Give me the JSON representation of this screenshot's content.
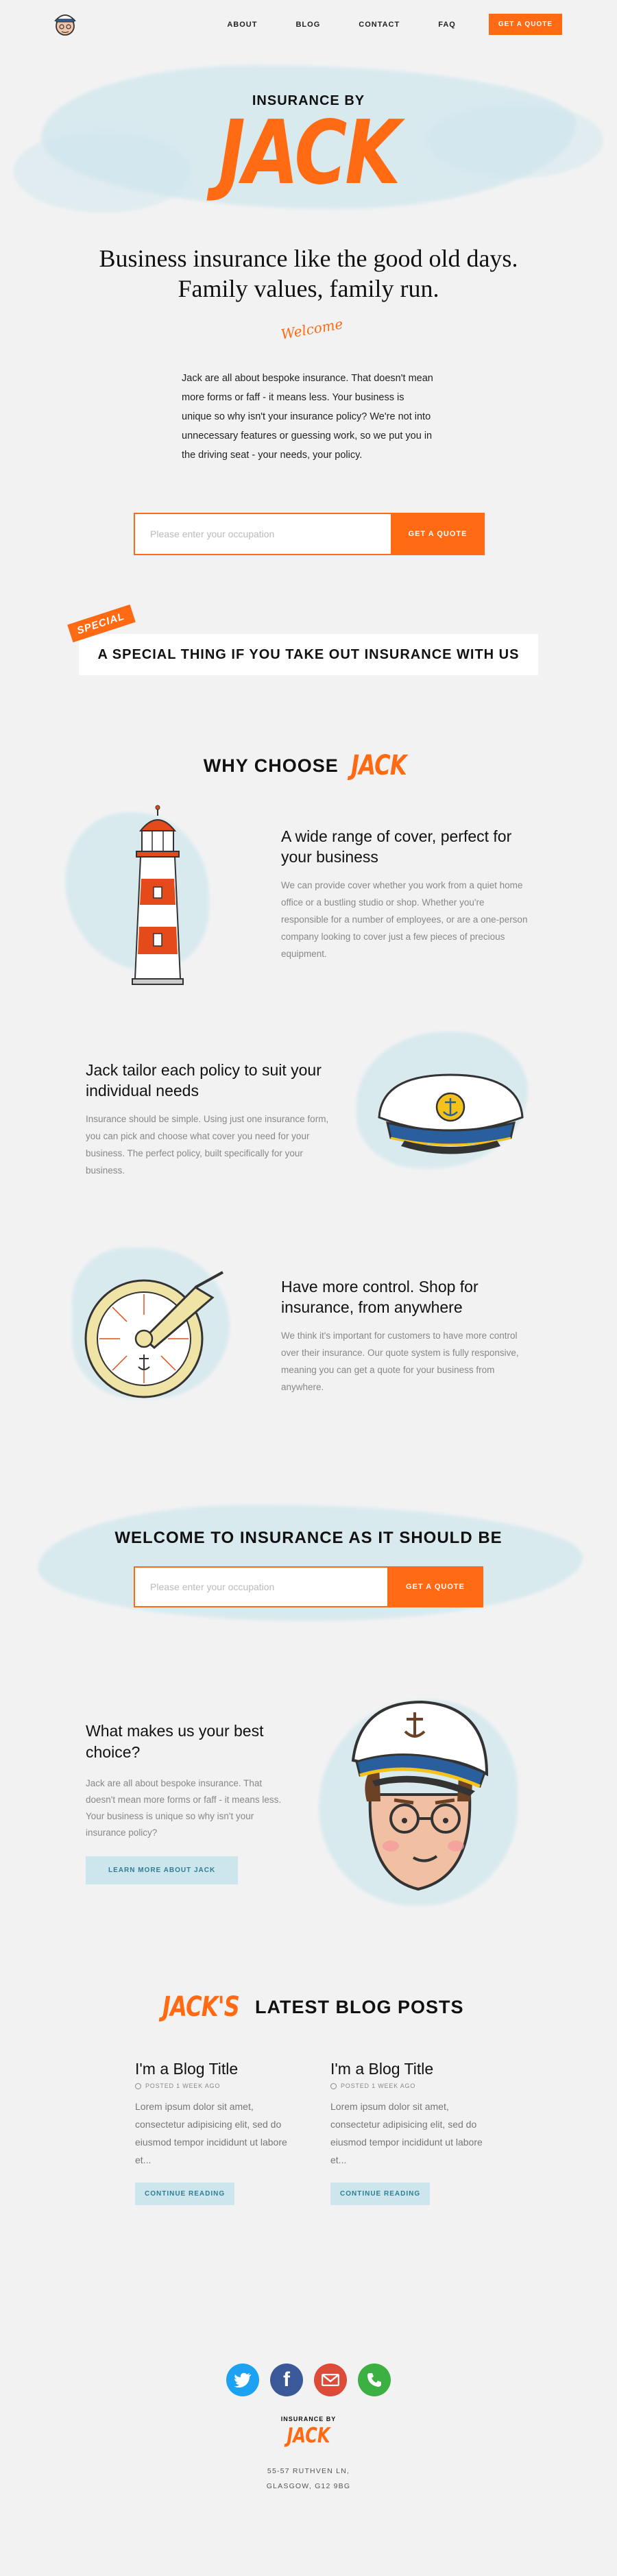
{
  "header": {
    "nav": [
      "ABOUT",
      "BLOG",
      "CONTACT",
      "FAQ"
    ],
    "quote_button": "GET A QUOTE"
  },
  "hero": {
    "small_title": "INSURANCE BY",
    "big_title": "JACK",
    "tagline_line1": "Business insurance like the good old days.",
    "tagline_line2": "Family values, family run.",
    "welcome": "Welcome",
    "intro": "Jack are all about bespoke insurance. That doesn't mean more forms or faff - it means less. Your business is unique so why isn't your insurance policy? We're not into unnecessary features or guessing work, so we put you in the driving seat - your needs, your policy.",
    "input_placeholder": "Please enter your occupation",
    "button": "GET A QUOTE"
  },
  "special": {
    "tag": "SPECIAL",
    "text": "A SPECIAL THING IF YOU TAKE OUT INSURANCE WITH US"
  },
  "why": {
    "title": "WHY CHOOSE",
    "accent": "JACK",
    "features": [
      {
        "title": "A wide range of cover, perfect for your business",
        "body": "We can provide cover whether you work from a quiet home office or a bustling studio or shop. Whether you're responsible for a number of employees, or are a one-person company looking to cover just a few pieces of precious equipment."
      },
      {
        "title": "Jack tailor each policy to suit your individual needs",
        "body": "Insurance should be simple. Using just one insurance form, you can pick and choose what cover you need for your business. The perfect policy, built specifically for your business."
      },
      {
        "title": "Have more control. Shop for insurance, from anywhere",
        "body": "We think it's important for customers to have more control over their insurance. Our quote system is fully responsive, meaning you can get a quote for your business from anywhere."
      }
    ]
  },
  "welcome_section": {
    "title": "WELCOME TO INSURANCE AS IT SHOULD BE",
    "input_placeholder": "Please enter your occupation",
    "button": "GET A QUOTE"
  },
  "best_choice": {
    "title": "What makes us your best choice?",
    "body": "Jack are all about bespoke insurance. That doesn't mean more forms or faff - it means less. Your business is unique so why isn't your insurance policy?",
    "button": "LEARN MORE ABOUT JACK"
  },
  "blog": {
    "accent": "JACK'S",
    "title": "LATEST BLOG POSTS",
    "posts": [
      {
        "title": "I'm a Blog Title",
        "meta": "POSTED 1 WEEK AGO",
        "excerpt": "Lorem ipsum dolor sit amet, consectetur adipisicing elit, sed do eiusmod tempor incididunt ut labore et...",
        "button": "CONTINUE READING"
      },
      {
        "title": "I'm a Blog Title",
        "meta": "POSTED 1 WEEK AGO",
        "excerpt": "Lorem ipsum dolor sit amet, consectetur adipisicing elit, sed do eiusmod tempor incididunt ut labore et...",
        "button": "CONTINUE READING"
      }
    ]
  },
  "footer": {
    "small_title": "INSURANCE BY",
    "big_title": "JACK",
    "address_line1": "55-57 RUTHVEN LN,",
    "address_line2": "GLASGOW, G12 9BG",
    "socials": [
      {
        "name": "twitter-icon",
        "color": "#1da1f2"
      },
      {
        "name": "facebook-icon",
        "color": "#3b5998"
      },
      {
        "name": "mail-icon",
        "color": "#dd4b39"
      },
      {
        "name": "phone-icon",
        "color": "#3cb043"
      }
    ]
  },
  "colors": {
    "accent": "#ff6a13",
    "wash": "#cfe7ee",
    "background": "#f2f2f2"
  }
}
